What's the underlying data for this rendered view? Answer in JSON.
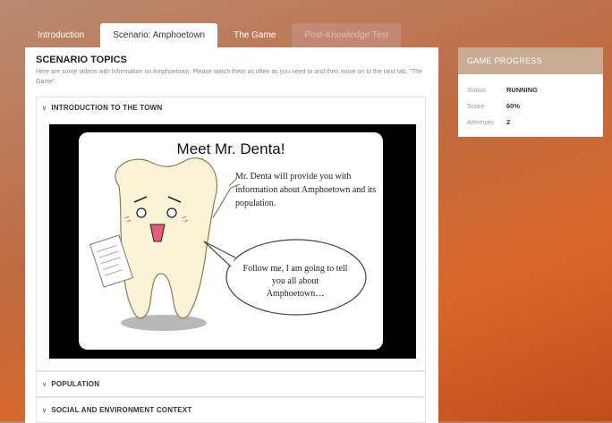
{
  "tabs": [
    {
      "label": "Introduction"
    },
    {
      "label": "Scenario: Amphoetown"
    },
    {
      "label": "The Game"
    },
    {
      "label": "Post-Knowledge Test"
    }
  ],
  "main": {
    "title": "SCENARIO TOPICS",
    "description": "Here are some videos with information on Amphoetown. Please watch them as often as you need to and then move on to the next tab, \"The Game\".",
    "sections": [
      {
        "label": "INTRODUCTION TO THE TOWN",
        "expanded": true
      },
      {
        "label": "POPULATION",
        "expanded": false
      },
      {
        "label": "SOCIAL AND ENVIRONMENT CONTEXT",
        "expanded": false
      }
    ],
    "video": {
      "slide_title": "Meet Mr. Denta!",
      "slide_text": "Mr. Denta will provide you with information about Amphoetown and its population.",
      "bubble_text": "Follow me, I am going to tell you all about Amphoetown…"
    }
  },
  "progress": {
    "title": "GAME PROGRESS",
    "status_label": "Status",
    "status_value": "RUNNING",
    "score_label": "Score",
    "score_value": "60%",
    "attempts_label": "Attempts",
    "attempts_value": "2"
  },
  "icons": {
    "section_chevron": "chevron-down-icon"
  },
  "colors": {
    "panel_header": "#c9aa93",
    "background_accent": "#d9682a"
  }
}
